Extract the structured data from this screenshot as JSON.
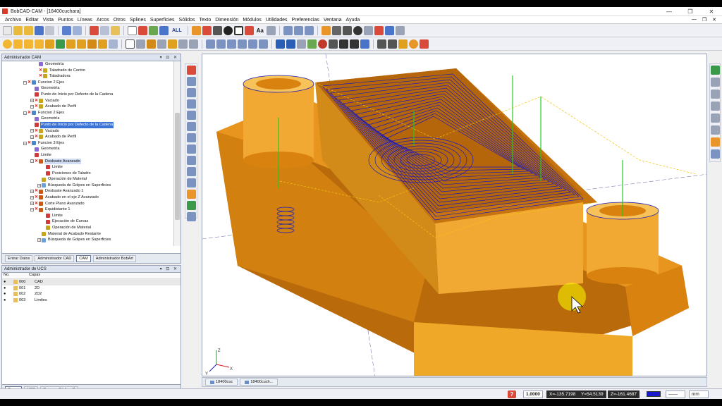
{
  "window": {
    "title": "BobCAD-CAM - [18400cuchara]",
    "min": "—",
    "max": "❐",
    "close": "✕"
  },
  "menu": [
    "Archivo",
    "Editar",
    "Vista",
    "Puntos",
    "Líneas",
    "Arcos",
    "Otros",
    "Splines",
    "Superficies",
    "Sólidos",
    "Texto",
    "Dimensión",
    "Módulos",
    "Utilidades",
    "Preferencias",
    "Ventana",
    "Ayuda"
  ],
  "mdi_controls": [
    "—",
    "❐",
    "✕"
  ],
  "toolbar1": {
    "all_label": "ALL"
  },
  "cam_panel": {
    "title": "Administrador CAM",
    "tree": [
      {
        "label": "Geometría",
        "indent": 52,
        "x": false,
        "exp": "",
        "icon": "#8a6bd0"
      },
      {
        "label": "Taladrado de Centro",
        "indent": 52,
        "x": true,
        "exp": "",
        "icon": "#c6a51a"
      },
      {
        "label": "Taladradora",
        "indent": 52,
        "x": true,
        "exp": "",
        "icon": "#c6a51a"
      },
      {
        "label": "Funcion 2 Ejes",
        "indent": 30,
        "x": true,
        "exp": "−",
        "icon": "#4a86c9"
      },
      {
        "label": "Geometría",
        "indent": 46,
        "x": false,
        "exp": "",
        "icon": "#8a6bd0"
      },
      {
        "label": "Punto de Inicio por Defecto de la Cadena",
        "indent": 46,
        "x": false,
        "exp": "",
        "icon": "#d03a3a"
      },
      {
        "label": "Vaciado",
        "indent": 40,
        "x": true,
        "exp": "+",
        "icon": "#c6a51a"
      },
      {
        "label": "Acabado de Perfil",
        "indent": 40,
        "x": true,
        "exp": "+",
        "icon": "#c6a51a"
      },
      {
        "label": "Funcion 2 Ejes",
        "indent": 30,
        "x": true,
        "exp": "−",
        "icon": "#4a86c9"
      },
      {
        "label": "Geometría",
        "indent": 46,
        "x": false,
        "exp": "",
        "icon": "#8a6bd0"
      },
      {
        "label": "Punto de Inicio por Defecto de la Cadena",
        "indent": 46,
        "x": false,
        "exp": "",
        "icon": "#d03a3a",
        "sel": true
      },
      {
        "label": "Vaciado",
        "indent": 40,
        "x": true,
        "exp": "+",
        "icon": "#c6a51a"
      },
      {
        "label": "Acabado de Perfil",
        "indent": 40,
        "x": true,
        "exp": "+",
        "icon": "#c6a51a"
      },
      {
        "label": "Funcion 3 Ejes",
        "indent": 30,
        "x": true,
        "exp": "−",
        "icon": "#4a86c9"
      },
      {
        "label": "Geometría",
        "indent": 46,
        "x": false,
        "exp": "",
        "icon": "#8a6bd0"
      },
      {
        "label": "Limite",
        "indent": 46,
        "x": false,
        "exp": "",
        "icon": "#d03a3a"
      },
      {
        "label": "Desbaste Avanzado",
        "indent": 40,
        "x": true,
        "exp": "−",
        "icon": "#c65a1a",
        "hl": true
      },
      {
        "label": "Limite",
        "indent": 62,
        "x": false,
        "exp": "",
        "icon": "#d03a3a"
      },
      {
        "label": "Posiciones de Taladro",
        "indent": 62,
        "x": false,
        "exp": "",
        "icon": "#d03a3a"
      },
      {
        "label": "Operación de Material",
        "indent": 56,
        "x": false,
        "exp": "",
        "icon": "#c6a51a"
      },
      {
        "label": "Búsqueda de Golpes en Superficies",
        "indent": 50,
        "x": false,
        "exp": "+",
        "icon": "#6aa1d8"
      },
      {
        "label": "Desbaste Avanzado 1",
        "indent": 40,
        "x": true,
        "exp": "+",
        "icon": "#c65a1a"
      },
      {
        "label": "Acabado en el eje Z Avanzado",
        "indent": 40,
        "x": true,
        "exp": "+",
        "icon": "#c65a1a"
      },
      {
        "label": "Corte Plano Avanzado",
        "indent": 40,
        "x": true,
        "exp": "+",
        "icon": "#c65a1a"
      },
      {
        "label": "Equidistante 1",
        "indent": 40,
        "x": true,
        "exp": "−",
        "icon": "#c65a1a"
      },
      {
        "label": "Limite",
        "indent": 62,
        "x": false,
        "exp": "",
        "icon": "#d03a3a"
      },
      {
        "label": "Ejecución de Curvas",
        "indent": 62,
        "x": false,
        "exp": "",
        "icon": "#d03a3a"
      },
      {
        "label": "Operación de Material",
        "indent": 62,
        "x": false,
        "exp": "",
        "icon": "#c6a51a"
      },
      {
        "label": "Material de Acabado Restante",
        "indent": 56,
        "x": false,
        "exp": "",
        "icon": "#c6a51a"
      },
      {
        "label": "Búsqueda de Golpes en Superficies",
        "indent": 50,
        "x": false,
        "exp": "+",
        "icon": "#6aa1d8"
      }
    ],
    "tabs": [
      "Entrar Datos",
      "Administrador CAD",
      "CAM",
      "Administrador BobArt"
    ]
  },
  "ucs_panel": {
    "title": "Administrador de UCS",
    "columns": [
      "No.",
      "Capas"
    ],
    "layers": [
      {
        "no": "000",
        "name": "CAD",
        "visible": true,
        "sel": true
      },
      {
        "no": "001",
        "name": "2D",
        "visible": true,
        "sel": false
      },
      {
        "no": "002",
        "name": "2D2",
        "visible": true,
        "sel": false
      },
      {
        "no": "003",
        "name": "Limites",
        "visible": true,
        "sel": false
      }
    ],
    "tabs": [
      "Capas",
      "UCS",
      "Generar Código G"
    ]
  },
  "viewport": {
    "axis_labels": {
      "x": "X",
      "y": "Y",
      "z": "Z"
    },
    "colors": {
      "body": "#d9820f",
      "top": "#e8951f",
      "bore": "#f2a93a",
      "toolpath": "#1d1db8",
      "rapid": "#f1c40f",
      "drill": "#22cc22"
    }
  },
  "doc_tabs": [
    "18400cuc",
    "18400cuch..."
  ],
  "status": {
    "help": "?",
    "scale": "1.0000",
    "x": "X=-135.7198",
    "y": "Y=54.5139",
    "z": "Z=-161.4687",
    "line_style": "——",
    "units": "mm"
  }
}
